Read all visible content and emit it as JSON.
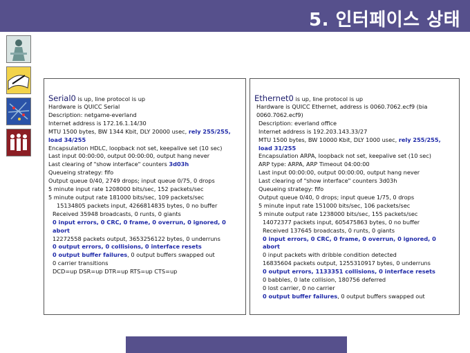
{
  "title": "5. 인터페이스 상태",
  "icons": [
    "people-meeting-icon",
    "writing-hand-icon",
    "network-map-icon",
    "group-people-icon"
  ],
  "colors": {
    "title_bar": "#56508c",
    "highlight": "#1f2aa8"
  },
  "serial": {
    "name": "Serial0",
    "status": " is up, line protocol is up",
    "lines": [
      {
        "text": "Hardware is QUICC Serial"
      },
      {
        "text": "Description: netgame-everland"
      },
      {
        "text": "Internet address is 172.16.1.14/30"
      },
      {
        "text": "MTU 1500 bytes, BW 1344 Kbit, DLY 20000 usec, ",
        "hl": "rely 255/255, load 34/255"
      },
      {
        "text": "Encapsulation HDLC, loopback not set, keepalive set (10 sec)"
      },
      {
        "text": "Last input 00:00:00, output 00:00:00, output hang never"
      },
      {
        "text": "Last clearing of \"show interface\" counters ",
        "hl": "3d03h"
      },
      {
        "text": "Queueing strategy: fifo"
      },
      {
        "text": "Output queue 0/40, 2749 drops; input queue 0/75, 0 drops"
      },
      {
        "text": "5 minute input rate 1208000 bits/sec, 152 packets/sec"
      },
      {
        "text": "5 minute output rate 181000 bits/sec, 109 packets/sec"
      },
      {
        "text": "15134805 packets input, 4266814835 bytes, 0 no buffer",
        "indent": 2
      },
      {
        "text": "Received 35948 broadcasts, 0 runts, 0 giants",
        "indent": 1
      },
      {
        "hl": "0 input errors, 0 CRC, 0 frame, 0 overrun, 0 ignored, 0 abort",
        "indent": 1
      },
      {
        "text": "12272558 packets output, 3653256122 bytes, 0 underruns",
        "indent": 1
      },
      {
        "hl": "0 output errors, 0 collisions, 0 interface resets",
        "indent": 1
      },
      {
        "hl": "0 output buffer failures",
        "text": ", 0 output buffers swapped out",
        "indent": 1
      },
      {
        "text": "0 carrier transitions",
        "indent": 1
      },
      {
        "text": "DCD=up  DSR=up  DTR=up  RTS=up  CTS=up",
        "indent": 1
      }
    ]
  },
  "ethernet": {
    "name": "Ethernet0",
    "status": " is up, line protocol is up",
    "lines": [
      {
        "text": "Hardware is QUICC Ethernet, address is 0060.7062.ecf9 (bia 0060.7062.ecf9)",
        "indent": 0.5
      },
      {
        "text": "Description: everland office",
        "indent": 1
      },
      {
        "text": "Internet address is 192.203.143.33/27",
        "indent": 1
      },
      {
        "text": "MTU 1500 bytes, BW 10000 Kbit, DLY 1000 usec, ",
        "hl": "rely 255/255, load 31/255",
        "indent": 1
      },
      {
        "text": "Encapsulation ARPA, loopback not set, keepalive set (10 sec)",
        "indent": 1
      },
      {
        "text": "ARP type: ARPA, ARP Timeout 04:00:00",
        "indent": 1
      },
      {
        "text": "Last input 00:00:00, output 00:00:00, output hang never",
        "indent": 1
      },
      {
        "text": "Last clearing of \"show interface\" counters 3d03h",
        "indent": 1
      },
      {
        "text": "Queueing strategy: fifo",
        "indent": 1
      },
      {
        "text": "Output queue 0/40, 0 drops; input queue 1/75, 0 drops",
        "indent": 1
      },
      {
        "text": "5 minute input rate 151000 bits/sec, 106 packets/sec",
        "indent": 1
      },
      {
        "text": "5 minute output rate 1238000 bits/sec, 155 packets/sec",
        "indent": 1
      },
      {
        "text": "14072377 packets input, 605475863 bytes, 0 no buffer",
        "indent": 2
      },
      {
        "text": "Received 137645 broadcasts, 0 runts, 0 giants",
        "indent": 2
      },
      {
        "hl": "0 input errors, 0 CRC, 0 frame, 0 overrun, 0 ignored, 0 abort",
        "indent": 2
      },
      {
        "text": "0 input packets with dribble condition detected",
        "indent": 2
      },
      {
        "text": "16835604 packets output, 1255310917 bytes, 0 underruns",
        "indent": 2
      },
      {
        "hl": "0 output errors, 1133351 collisions, 0 interface resets",
        "indent": 2
      },
      {
        "text": "0 babbles, 0 late collision, 180756 deferred",
        "indent": 2
      },
      {
        "text": "0 lost carrier, 0 no carrier",
        "indent": 2
      },
      {
        "hl": "0 output buffer failures",
        "text": ", 0 output buffers swapped out",
        "indent": 2
      }
    ]
  }
}
